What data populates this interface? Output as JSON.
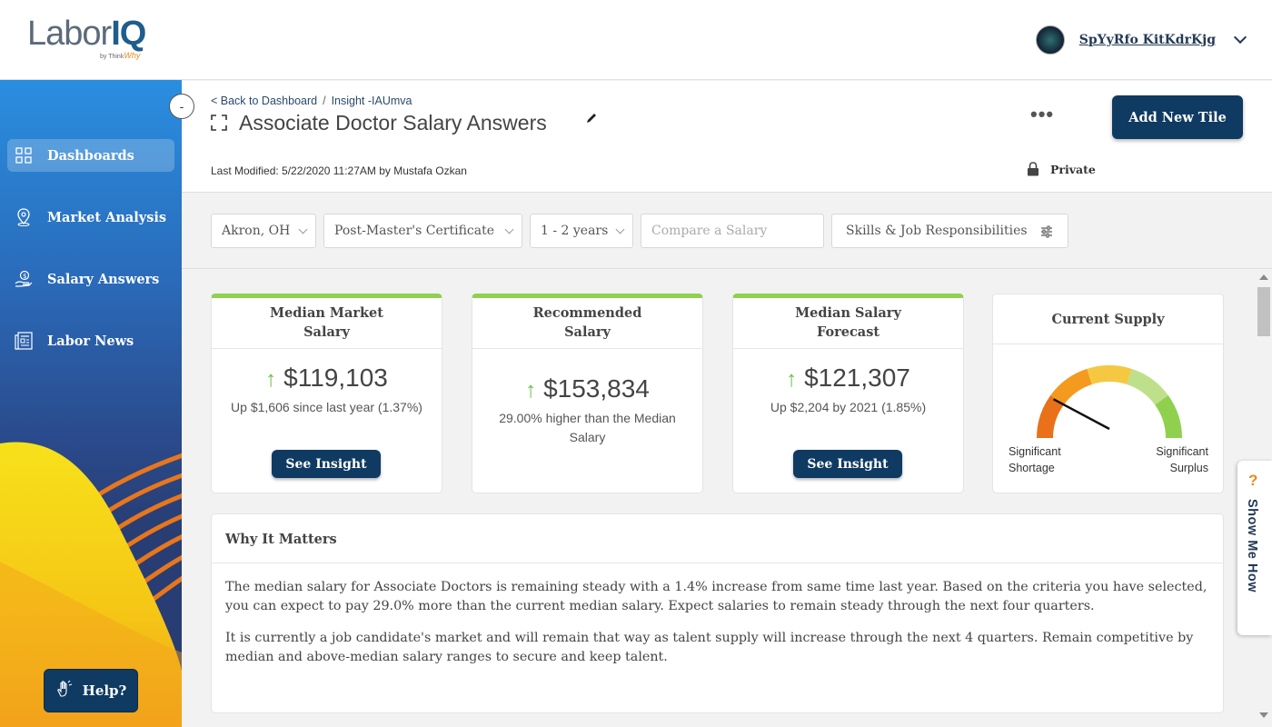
{
  "app": {
    "logo_text": "LaborIQ",
    "logo_sub_prefix": "by Think",
    "logo_sub_script": "Why"
  },
  "user": {
    "name": "SpYyRfo KitKdrKjg"
  },
  "sidebar": {
    "collapse_symbol": "-",
    "items": [
      {
        "label": "Dashboards",
        "icon": "dashboard-grid-icon",
        "active": true
      },
      {
        "label": "Market Analysis",
        "icon": "map-pin-icon",
        "active": false
      },
      {
        "label": "Salary Answers",
        "icon": "salary-hand-icon",
        "active": false
      },
      {
        "label": "Labor News",
        "icon": "newspaper-icon",
        "active": false
      }
    ],
    "help_label": "Help?"
  },
  "page": {
    "breadcrumb_back": "< Back to Dashboard",
    "breadcrumb_sep": "/",
    "breadcrumb_current": "Insight -IAUmva",
    "title": "Associate Doctor Salary Answers",
    "last_modified": "Last Modified: 5/22/2020 11:27AM by Mustafa Ozkan",
    "more_label": "•••",
    "add_tile_label": "Add New Tile",
    "visibility": "Private"
  },
  "filters": {
    "location": "Akron, OH",
    "education": "Post-Master's Certificate",
    "experience": "1 - 2 years",
    "compare_placeholder": "Compare a Salary",
    "skills_label": "Skills & Job Responsibilities"
  },
  "cards": [
    {
      "title_line1": "Median Market",
      "title_line2": "Salary",
      "arrow": "↑",
      "value": "$119,103",
      "sub": "Up $1,606 since last year (1.37%)",
      "button": "See Insight"
    },
    {
      "title_line1": "Recommended",
      "title_line2": "Salary",
      "arrow": "↑",
      "value": "$153,834",
      "sub": "29.00% higher than the Median Salary",
      "button": ""
    },
    {
      "title_line1": "Median Salary",
      "title_line2": "Forecast",
      "arrow": "↑",
      "value": "$121,307",
      "sub": "Up $2,204 by 2021 (1.85%)",
      "button": "See Insight"
    }
  ],
  "supply": {
    "title": "Current Supply",
    "left_label_1": "Significant",
    "left_label_2": "Shortage",
    "right_label_1": "Significant",
    "right_label_2": "Surplus",
    "level": 0.1,
    "colors": [
      "#e8711a",
      "#f39a1f",
      "#f5c842",
      "#bfe08a",
      "#8fd14f"
    ]
  },
  "why": {
    "title": "Why It Matters",
    "p1": "The median salary for Associate Doctors is remaining steady with a 1.4% increase from same time last year. Based on the criteria you have selected, you can expect to pay 29.0% more than the current median salary. Expect salaries to remain steady through the next four quarters.",
    "p2": "It is currently a job candidate's market and will remain that way as talent supply will increase through the next 4 quarters. Remain competitive by median and above-median salary ranges to secure and keep talent."
  },
  "help_tab": {
    "symbol": "?",
    "label": "Show Me How"
  }
}
